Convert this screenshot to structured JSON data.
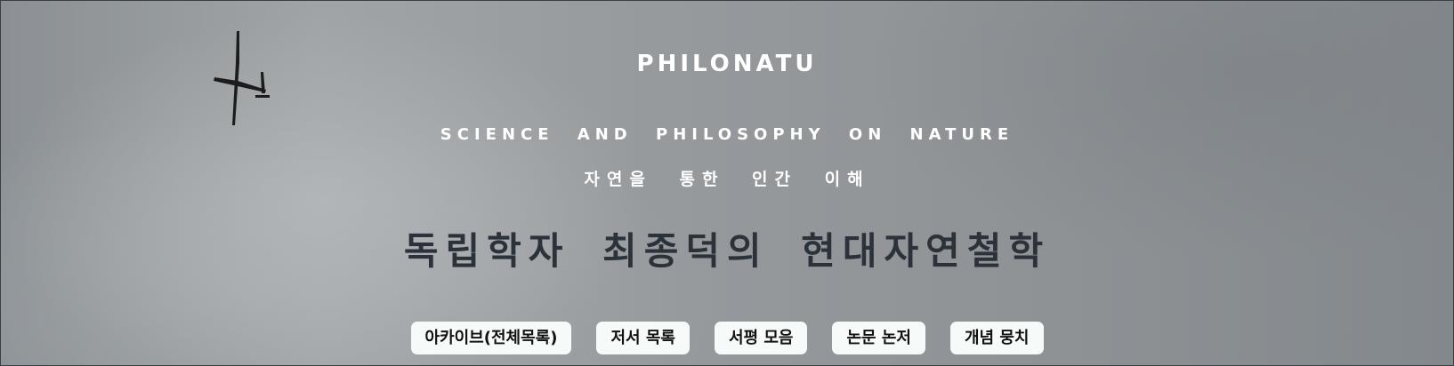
{
  "header": {
    "site_title": "PHILONATU",
    "subtitle_en": "SCIENCE AND PHILOSOPHY ON NATURE",
    "subtitle_ko": "자연을 통한 인간 이해",
    "headline": "독립학자 최종덕의 현대자연철학"
  },
  "nav": {
    "items": [
      {
        "label": "아카이브(전체목록)"
      },
      {
        "label": "저서 목록"
      },
      {
        "label": "서평 모음"
      },
      {
        "label": "논문 논저"
      },
      {
        "label": "개념 뭉치"
      }
    ]
  },
  "colors": {
    "title_text": "#ffffff",
    "headline_text": "#2b323a",
    "button_bg": "#f6fbfa",
    "button_text": "#111111",
    "sky": "#969a9d"
  },
  "background": {
    "image": "overcast sky with glider"
  }
}
